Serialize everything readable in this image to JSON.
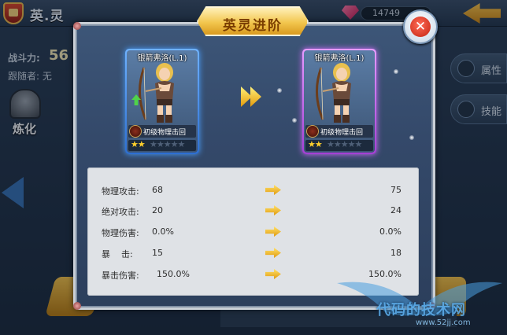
{
  "background": {
    "title": "英.灵",
    "gem_count": "14749",
    "power_label": "战斗力:",
    "power_value": "56",
    "follower_label": "跟随者: 无",
    "refine_label": "炼化",
    "side_tabs": [
      {
        "label": "属性",
        "icon": "attribute-icon"
      },
      {
        "label": "技能",
        "icon": "skill-icon"
      }
    ],
    "watermark_text": "代码的技术网",
    "watermark_url": "www.52jj.com"
  },
  "modal": {
    "title": "英灵进阶",
    "before_card": {
      "name": "银箭弗洛(L.1)",
      "skill": "初级物理击回",
      "stars_filled": 2,
      "stars_total": 7
    },
    "after_card": {
      "name": "银箭弗洛(L.1)",
      "skill": "初级物理击回",
      "stars_filled": 2,
      "stars_total": 7
    },
    "stats": [
      {
        "label": "物理攻击:",
        "old": "68",
        "new": "75"
      },
      {
        "label": "绝对攻击:",
        "old": "20",
        "new": "24"
      },
      {
        "label": "物理伤害:",
        "old": "0.0%",
        "new": "0.0%"
      },
      {
        "label": "暴    击:",
        "old": "15",
        "new": "18"
      },
      {
        "label": "暴击伤害:",
        "old": "150.0%",
        "new": "150.0%"
      }
    ]
  },
  "colors": {
    "card_before": "#2d6fd3",
    "card_after": "#a63fd6",
    "title_gold": "#f2c64e",
    "close_red": "#c3220f"
  }
}
